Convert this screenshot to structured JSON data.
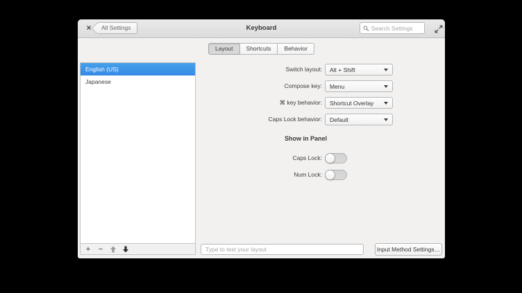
{
  "window": {
    "title": "Keyboard",
    "back_button_label": "All Settings",
    "search_placeholder": "Search Settings"
  },
  "icons": {
    "close": "×",
    "add": "+",
    "remove": "−"
  },
  "tabs": [
    {
      "label": "Layout",
      "active": true
    },
    {
      "label": "Shortcuts",
      "active": false
    },
    {
      "label": "Behavior",
      "active": false
    }
  ],
  "layout_list": {
    "items": [
      {
        "label": "English (US)",
        "selected": true
      },
      {
        "label": "Japanese",
        "selected": false
      }
    ]
  },
  "settings_rows": [
    {
      "label": "Switch layout:",
      "value": "Alt + Shift"
    },
    {
      "label": "Compose key:",
      "value": "Menu"
    },
    {
      "label": "⌘ key behavior:",
      "value": "Shortcut Overlay"
    },
    {
      "label": "Caps Lock behavior:",
      "value": "Default"
    }
  ],
  "show_in_panel": {
    "heading": "Show in Panel",
    "toggles": [
      {
        "label": "Caps Lock:",
        "on": false
      },
      {
        "label": "Num Lock:",
        "on": false
      }
    ]
  },
  "footer": {
    "test_input_placeholder": "Type to test your layout",
    "input_method_button_label": "Input Method Settings…"
  },
  "colors": {
    "selection_blue": "#3b97e4",
    "headerbar_gray": "#e4e4e4",
    "content_gray": "#f2f1f0"
  }
}
